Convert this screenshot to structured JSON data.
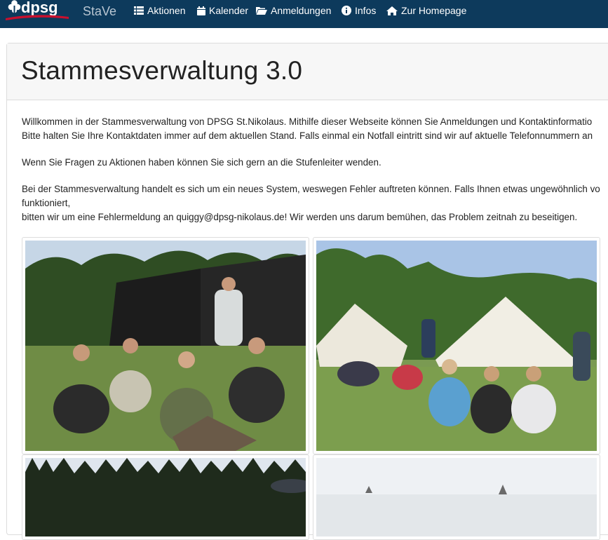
{
  "navbar": {
    "logo_text": "dpsg",
    "brand": "StaVe",
    "items": [
      {
        "label": "Aktionen",
        "icon": "list-icon"
      },
      {
        "label": "Kalender",
        "icon": "calendar-icon"
      },
      {
        "label": "Anmeldungen",
        "icon": "folder-open-icon"
      },
      {
        "label": "Infos",
        "icon": "info-circle-icon"
      },
      {
        "label": "Zur Homepage",
        "icon": "home-icon"
      }
    ]
  },
  "page": {
    "title": "Stammesverwaltung 3.0",
    "paragraphs": [
      "Willkommen in der Stammesverwaltung von DPSG St.Nikolaus. Mithilfe dieser Webseite können Sie Anmeldungen und Kontaktinformatio",
      "Bitte halten Sie Ihre Kontaktdaten immer auf dem aktuellen Stand. Falls einmal ein Notfall eintritt sind wir auf aktuelle Telefonnummern an",
      "Wenn Sie Fragen zu Aktionen haben können Sie sich gern an die Stufenleiter wenden.",
      "Bei der Stammesverwaltung handelt es sich um ein neues System, weswegen Fehler auftreten können. Falls Ihnen etwas ungewöhnlich vo",
      "funktioniert,",
      "bitten wir um eine Fehlermeldung an quiggy@dpsg-nikolaus.de! Wir werden uns darum bemühen, das Problem zeitnah zu beseitigen."
    ]
  },
  "gallery": {
    "photos": [
      {
        "subject": "group-sitting-by-black-tents-photo"
      },
      {
        "subject": "group-sitting-by-white-tents-photo"
      },
      {
        "subject": "forest-treeline-photo"
      },
      {
        "subject": "sky-field-photo"
      }
    ]
  },
  "colors": {
    "navbar_bg": "#0d3a5c",
    "brand_text": "#b9c6d2",
    "logo_accent": "#c8102e"
  }
}
